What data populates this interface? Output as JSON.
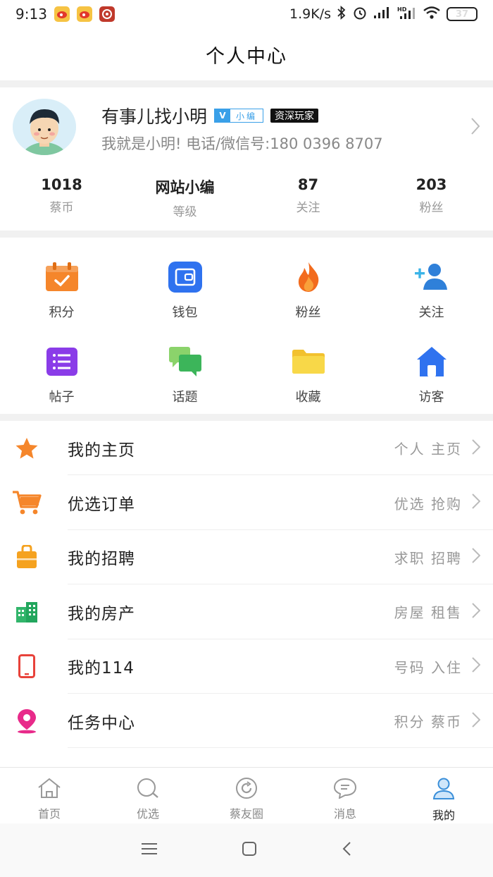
{
  "status": {
    "time": "9:13",
    "net_speed": "1.9K/s",
    "battery": "37"
  },
  "header": {
    "title": "个人中心"
  },
  "profile": {
    "nickname": "有事儿找小明",
    "v_badge_letter": "V",
    "v_badge_text": "小编",
    "level_badge": "资深玩家",
    "bio": "我就是小明! 电话/微信号:180 0396 8707"
  },
  "stats": [
    {
      "value": "1018",
      "label": "蔡币"
    },
    {
      "value": "网站小编",
      "label": "等级"
    },
    {
      "value": "87",
      "label": "关注"
    },
    {
      "value": "203",
      "label": "粉丝"
    }
  ],
  "grid": [
    {
      "label": "积分",
      "icon": "calendar-check-icon"
    },
    {
      "label": "钱包",
      "icon": "wallet-icon"
    },
    {
      "label": "粉丝",
      "icon": "flame-icon"
    },
    {
      "label": "关注",
      "icon": "add-user-icon"
    },
    {
      "label": "帖子",
      "icon": "list-icon"
    },
    {
      "label": "话题",
      "icon": "chat-bubbles-icon"
    },
    {
      "label": "收藏",
      "icon": "folder-icon"
    },
    {
      "label": "访客",
      "icon": "home-icon"
    }
  ],
  "menu": [
    {
      "label": "我的主页",
      "hint": "个人 主页",
      "icon": "star-icon"
    },
    {
      "label": "优选订单",
      "hint": "优选 抢购",
      "icon": "cart-icon"
    },
    {
      "label": "我的招聘",
      "hint": "求职 招聘",
      "icon": "briefcase-icon"
    },
    {
      "label": "我的房产",
      "hint": "房屋 租售",
      "icon": "building-icon"
    },
    {
      "label": "我的114",
      "hint": "号码 入住",
      "icon": "phone-icon"
    },
    {
      "label": "任务中心",
      "hint": "积分 蔡币",
      "icon": "location-pin-icon"
    }
  ],
  "tabs": [
    {
      "label": "首页",
      "icon": "home-outline-icon"
    },
    {
      "label": "优选",
      "icon": "search-outline-icon"
    },
    {
      "label": "蔡友圈",
      "icon": "refresh-circle-icon"
    },
    {
      "label": "消息",
      "icon": "message-icon"
    },
    {
      "label": "我的",
      "icon": "user-icon",
      "active": true
    }
  ],
  "colors": {
    "accent": "#3aa0e8",
    "orange": "#f5862b",
    "separator": "#f1f1f1"
  }
}
